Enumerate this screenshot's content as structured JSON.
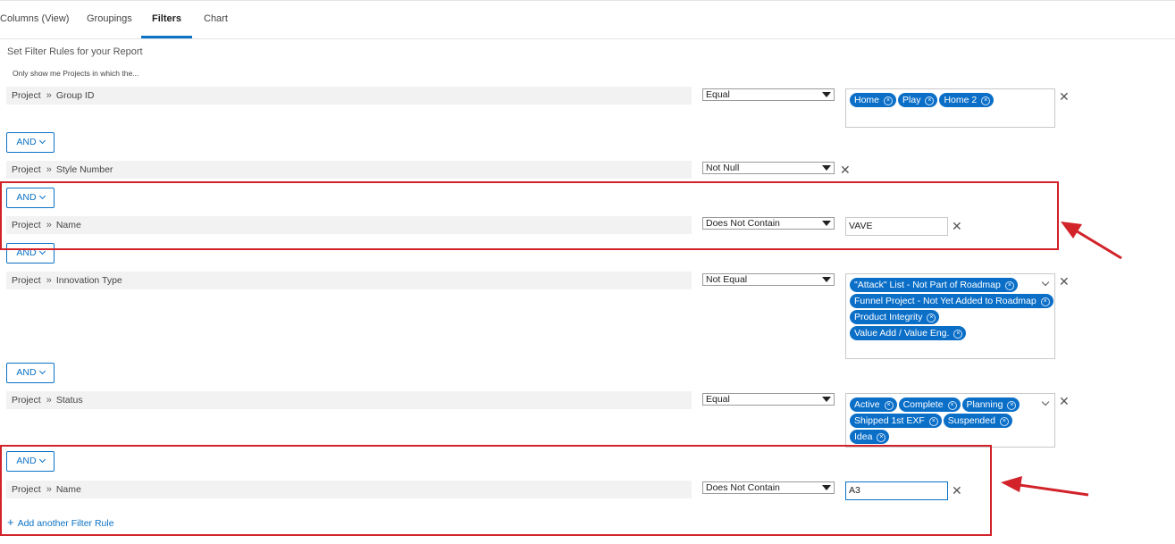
{
  "tabs": [
    "Columns (View)",
    "Groupings",
    "Filters",
    "Chart"
  ],
  "active_tab": "Filters",
  "heading": "Set Filter Rules for your Report",
  "subheading": "Only show me Projects in which the...",
  "path_separator": "»",
  "and_label": "AND",
  "remove_symbol": "✕",
  "chip_remove_symbol": "×",
  "rules": [
    {
      "object": "Project",
      "field": "Group ID",
      "operator": "Equal",
      "values": [
        "Home",
        "Play",
        "Home 2"
      ]
    },
    {
      "object": "Project",
      "field": "Style Number",
      "operator": "Not Null"
    },
    {
      "object": "Project",
      "field": "Name",
      "operator": "Does Not Contain",
      "value": "VAVE"
    },
    {
      "object": "Project",
      "field": "Innovation Type",
      "operator": "Not Equal",
      "values": [
        "\"Attack\" List - Not Part of Roadmap",
        "Funnel Project - Not Yet Added to Roadmap",
        "Product Integrity",
        "Value Add / Value Eng."
      ]
    },
    {
      "object": "Project",
      "field": "Status",
      "operator": "Equal",
      "values": [
        "Active",
        "Complete",
        "Planning",
        "Shipped 1st EXF",
        "Suspended",
        "Idea"
      ]
    },
    {
      "object": "Project",
      "field": "Name",
      "operator": "Does Not Contain",
      "value": "A3"
    }
  ],
  "add_rule_label": "Add another Filter Rule",
  "colors": {
    "accent": "#0b72c6",
    "chip": "#0b6fc8",
    "annotation": "#d2222a"
  }
}
